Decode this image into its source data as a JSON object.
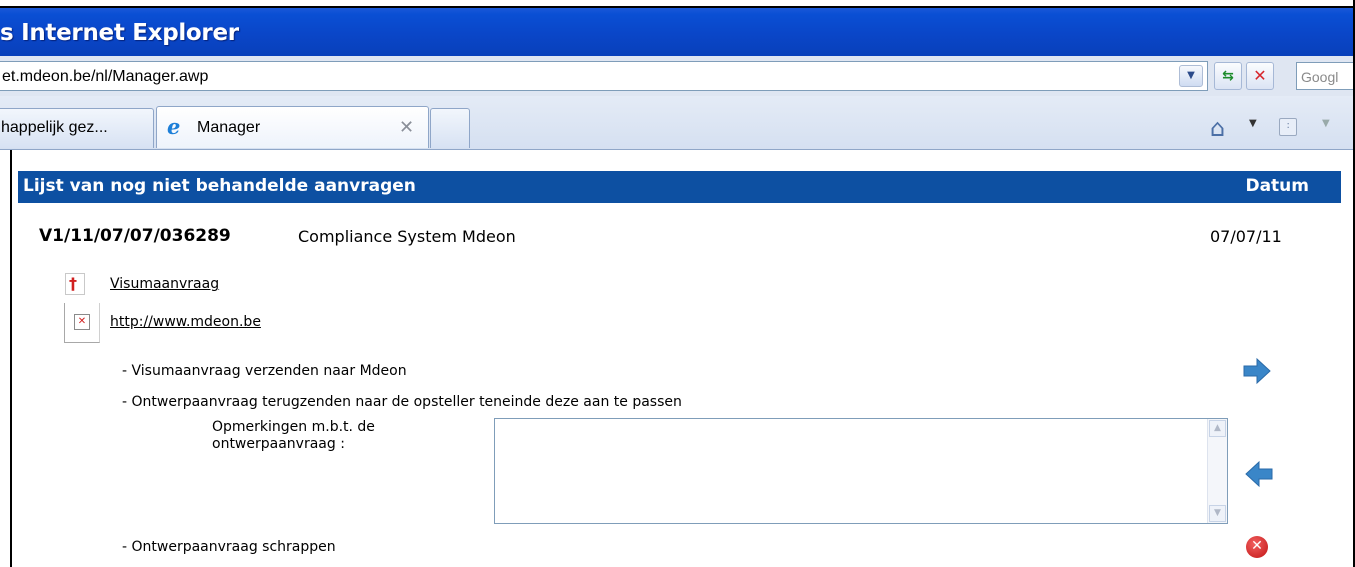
{
  "window": {
    "title": "s Internet Explorer"
  },
  "address_bar": {
    "url": "et.mdeon.be/nl/Manager.awp"
  },
  "search": {
    "placeholder": "Googl"
  },
  "tabs": [
    {
      "label": "happelijk gez..."
    },
    {
      "label": "Manager"
    },
    {
      "label": ""
    }
  ],
  "icons": {
    "refresh": "refresh-icon",
    "stop": "stop-icon",
    "home": "home-icon",
    "feeds": "feed-icon",
    "send": "arrow-right-icon",
    "return": "arrow-left-icon",
    "delete": "delete-icon"
  },
  "colors": {
    "header_bar": "#0d50a2",
    "titlebar": "#0a46c8",
    "arrow": "#3a86c8",
    "delete": "#c11414"
  },
  "list": {
    "title": "Lijst van nog niet behandelde aanvragen",
    "date_header": "Datum"
  },
  "request": {
    "id": "V1/11/07/07/036289",
    "name": "Compliance System Mdeon",
    "date": "07/07/11",
    "document_link": "Visumaanvraag",
    "url_link": "http://www.mdeon.be"
  },
  "actions": {
    "send": "- Visumaanvraag verzenden naar Mdeon",
    "return": "- Ontwerpaanvraag terugzenden naar de opsteller teneinde deze aan te passen",
    "remarks_label": "Opmerkingen m.b.t. de ontwerpaanvraag :",
    "delete": "- Ontwerpaanvraag schrappen"
  }
}
